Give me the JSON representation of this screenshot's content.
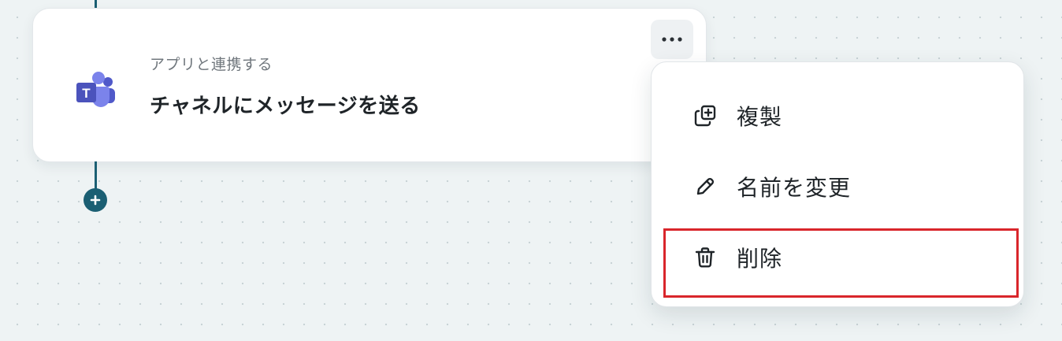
{
  "step": {
    "app_label": "アプリと連携する",
    "action_title": "チャネルにメッセージを送る",
    "app_icon": "microsoft-teams-icon",
    "more_icon": "ellipsis-icon"
  },
  "menu": {
    "items": [
      {
        "label": "複製",
        "icon": "duplicate-icon"
      },
      {
        "label": "名前を変更",
        "icon": "pencil-icon"
      },
      {
        "label": "削除",
        "icon": "trash-icon"
      }
    ],
    "highlighted_item": "削除"
  },
  "flow": {
    "add_icon": "plus-icon"
  },
  "colors": {
    "connector": "#1b5f73",
    "highlight": "#d9262b",
    "teams_purple": "#5b5fc7"
  }
}
